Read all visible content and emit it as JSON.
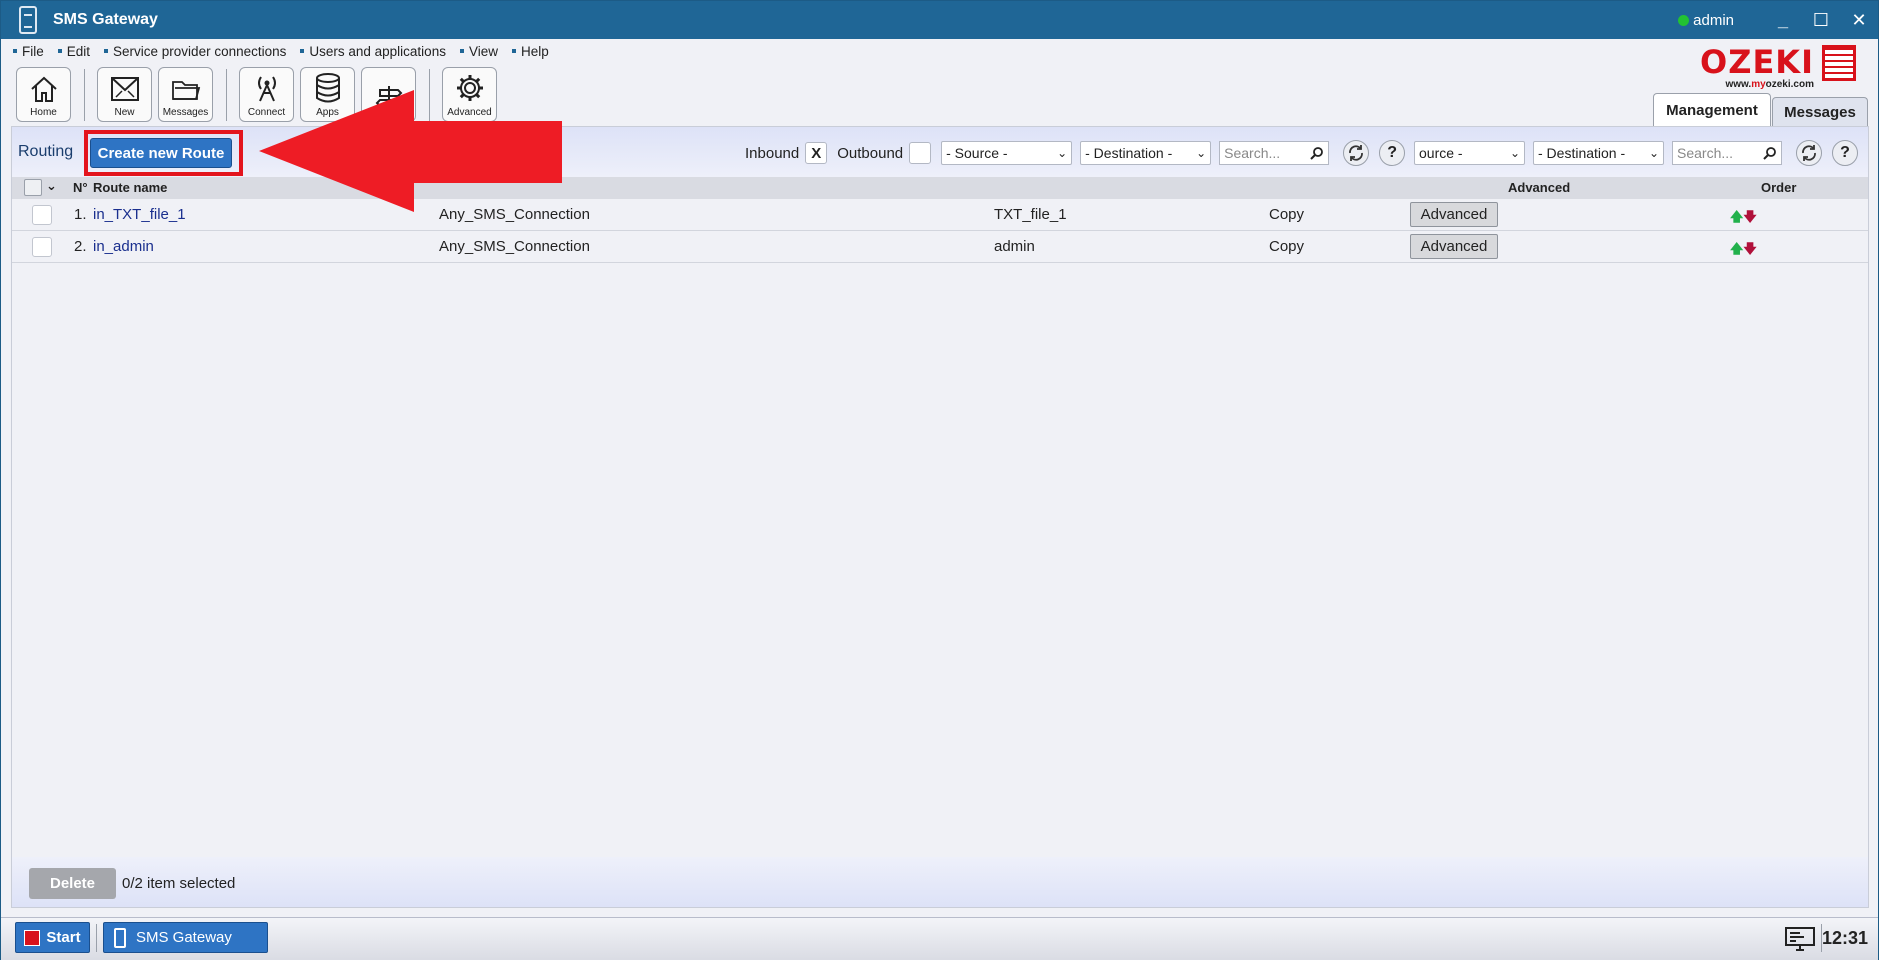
{
  "window": {
    "title": "SMS Gateway",
    "user": "admin",
    "minimize": "_",
    "maximize": "☐",
    "close": "✕"
  },
  "menu": [
    "File",
    "Edit",
    "Service provider connections",
    "Users and applications",
    "View",
    "Help"
  ],
  "toolbar": {
    "home": "Home",
    "new": "New",
    "messages": "Messages",
    "connect": "Connect",
    "apps": "Apps",
    "advanced": "Advanced"
  },
  "logo": {
    "word": "OZEKI",
    "url_prefix": "www.",
    "url_brand": "my",
    "url_suffix": "ozeki.com"
  },
  "tabs": {
    "management": "Management",
    "messages": "Messages"
  },
  "routing": {
    "label": "Routing",
    "create_button": "Create new Route"
  },
  "filters": {
    "inbound_label": "Inbound",
    "inbound_mark": "X",
    "outbound_label": "Outbound",
    "source": "- Source -",
    "destination": "- Destination -",
    "search_placeholder": "Search...",
    "source_clipped": "ource -",
    "destination2": "- Destination -",
    "search_placeholder2": "Search...",
    "help": "?"
  },
  "table": {
    "headers": {
      "number": "N°",
      "route_name": "Route name",
      "advanced": "Advanced",
      "order": "Order"
    },
    "rows": [
      {
        "num": "1.",
        "name": "in_TXT_file_1",
        "source": "Any_SMS_Connection",
        "destination": "TXT_file_1",
        "mode": "Copy",
        "advanced": "Advanced",
        "order_up": "🡅",
        "order_down": "🡇"
      },
      {
        "num": "2.",
        "name": "in_admin",
        "source": "Any_SMS_Connection",
        "destination": "admin",
        "mode": "Copy",
        "advanced": "Advanced",
        "order_up": "🡅",
        "order_down": "🡇"
      }
    ]
  },
  "footer": {
    "delete": "Delete",
    "selected": "0/2 item selected"
  },
  "taskbar": {
    "start": "Start",
    "app": "SMS Gateway",
    "clock": "12:31"
  },
  "colors": {
    "titlebar": "#1f6696",
    "accent_button": "#2e74c4",
    "logo_red": "#d8121b",
    "highlight_red": "#e3141d",
    "status_online": "#22c232"
  },
  "icons": {
    "home": "home-icon",
    "new": "new-envelope-icon",
    "messages": "folder-icon",
    "connect": "antenna-icon",
    "apps": "database-icon",
    "routing": "signpost-icon",
    "advanced": "gear-icon",
    "refresh": "refresh-icon",
    "help": "help-icon",
    "search": "search-icon"
  }
}
